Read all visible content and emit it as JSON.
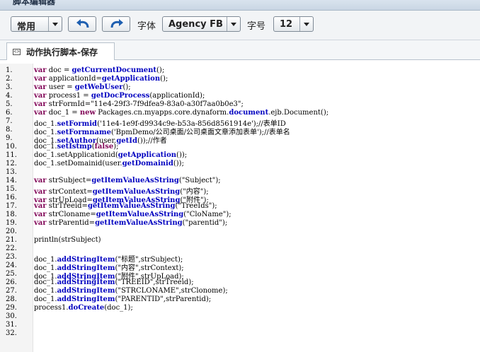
{
  "window": {
    "title": "脚本编辑器"
  },
  "toolbar": {
    "mode_select": "常用",
    "font_label": "字体",
    "font_select": "Agency FB",
    "size_label": "字号",
    "size_select": "12",
    "undo_icon": "undo-icon",
    "redo_icon": "redo-icon"
  },
  "tab": {
    "label": "动作执行脚本-保存",
    "icon": "script-icon"
  },
  "colors": {
    "keyword": "#7f0055",
    "function": "#0000c0",
    "string": "#2a00ff"
  },
  "lines": [
    [
      [
        "var",
        "kw"
      ],
      [
        " doc = ",
        ""
      ],
      [
        "getCurrentDocument",
        "fn"
      ],
      [
        "();",
        ""
      ]
    ],
    [
      [
        "var",
        "kw"
      ],
      [
        " applicationId=",
        ""
      ],
      [
        "getApplication",
        "fn"
      ],
      [
        "();",
        ""
      ]
    ],
    [
      [
        "var",
        "kw"
      ],
      [
        " user = ",
        ""
      ],
      [
        "getWebUser",
        "fn"
      ],
      [
        "();",
        ""
      ]
    ],
    [
      [
        "var",
        "kw"
      ],
      [
        " process1 = ",
        ""
      ],
      [
        "getDocProcess",
        "fn"
      ],
      [
        "(applicationId);",
        ""
      ]
    ],
    [
      [
        "var",
        "kw"
      ],
      [
        " strFormId=\"11e4-29f3-7f9dfea9-83a0-a30f7aa0b0e3\";",
        ""
      ]
    ],
    [
      [
        "var",
        "kw"
      ],
      [
        " doc_1 = ",
        ""
      ],
      [
        "new",
        "kw"
      ],
      [
        " Packages.cn.myapps.core.dynaform.",
        ""
      ],
      [
        "document",
        "fn"
      ],
      [
        ".ejb.Document();",
        ""
      ]
    ],
    [
      [
        "doc_1.",
        ""
      ],
      [
        "setFormid",
        "fn"
      ],
      [
        "('11e4-1e9f-d9934c9e-b53a-856d8561914e'",
        ""
      ],
      [
        ");",
        ""
      ],
      [
        "//表单ID",
        ""
      ]
    ],
    [
      [
        "doc_1.",
        ""
      ],
      [
        "setFormname",
        "fn"
      ],
      [
        "('BpmDemo/公司桌面/公司桌面文章添加表单'",
        ""
      ],
      [
        ");",
        ""
      ],
      [
        "//表单名",
        ""
      ]
    ],
    [
      [
        "doc_1.",
        ""
      ],
      [
        "setAuthor",
        "fn"
      ],
      [
        "(user.",
        ""
      ],
      [
        "getId",
        "fn"
      ],
      [
        "());//作者",
        ""
      ]
    ],
    [
      [
        "doc_1.",
        ""
      ],
      [
        "setIstmp",
        "fn"
      ],
      [
        "(",
        ""
      ],
      [
        "false",
        "kw"
      ],
      [
        ");",
        ""
      ]
    ],
    [
      [
        "doc_1.setApplicationid(",
        ""
      ],
      [
        "getApplication",
        "fn"
      ],
      [
        "());",
        ""
      ]
    ],
    [
      [
        "doc_1.setDomainid(user.",
        ""
      ],
      [
        "getDomainid",
        "fn"
      ],
      [
        "());",
        ""
      ]
    ],
    [],
    [
      [
        "var",
        "kw"
      ],
      [
        " strSubject=",
        ""
      ],
      [
        "getItemValueAsString",
        "fn"
      ],
      [
        "(\"Subject\"",
        ""
      ],
      [
        ");",
        ""
      ]
    ],
    [
      [
        "var",
        "kw"
      ],
      [
        " strContext=",
        ""
      ],
      [
        "getItemValueAsString",
        "fn"
      ],
      [
        "(\"内容\"",
        ""
      ],
      [
        ");",
        ""
      ]
    ],
    [
      [
        "var",
        "kw"
      ],
      [
        " strUpLoad=",
        ""
      ],
      [
        "getItemValueAsString",
        "fn"
      ],
      [
        "(\"附件\"",
        ""
      ],
      [
        ");",
        ""
      ]
    ],
    [
      [
        "var",
        "kw"
      ],
      [
        " strTreeid=",
        ""
      ],
      [
        "getItemValueAsString",
        "fn"
      ],
      [
        "(\"TreeIds\"",
        ""
      ],
      [
        ");",
        ""
      ]
    ],
    [
      [
        "var",
        "kw"
      ],
      [
        " strCloname=",
        ""
      ],
      [
        "getItemValueAsString",
        "fn"
      ],
      [
        "(\"CloName\"",
        ""
      ],
      [
        ");",
        ""
      ]
    ],
    [
      [
        "var",
        "kw"
      ],
      [
        " strParentid=",
        ""
      ],
      [
        "getItemValueAsString",
        "fn"
      ],
      [
        "(\"parentid\"",
        ""
      ],
      [
        ");",
        ""
      ]
    ],
    [],
    [
      [
        "println(strSubject)",
        ""
      ]
    ],
    [],
    [
      [
        "doc_1.",
        ""
      ],
      [
        "addStringItem",
        "fn"
      ],
      [
        "(\"标题\",strSubject);",
        ""
      ]
    ],
    [
      [
        "doc_1.",
        ""
      ],
      [
        "addStringItem",
        "fn"
      ],
      [
        "(\"内容\",strContext);",
        ""
      ]
    ],
    [
      [
        "doc_1.",
        ""
      ],
      [
        "addStringItem",
        "fn"
      ],
      [
        "(\"附件\",strUpLoad);",
        ""
      ]
    ],
    [
      [
        "doc_1.",
        ""
      ],
      [
        "addStringItem",
        "fn"
      ],
      [
        "(\"TREEID\",strTreeid);",
        ""
      ]
    ],
    [
      [
        "doc_1.",
        ""
      ],
      [
        "addStringItem",
        "fn"
      ],
      [
        "(\"STRCLONAME\",strClonome);",
        ""
      ]
    ],
    [
      [
        "doc_1.",
        ""
      ],
      [
        "addStringItem",
        "fn"
      ],
      [
        "(\"PARENTID\",strParentid);",
        ""
      ]
    ],
    [
      [
        "process1.",
        ""
      ],
      [
        "doCreate",
        "fn"
      ],
      [
        "(doc_1);",
        ""
      ]
    ],
    [],
    [],
    []
  ]
}
